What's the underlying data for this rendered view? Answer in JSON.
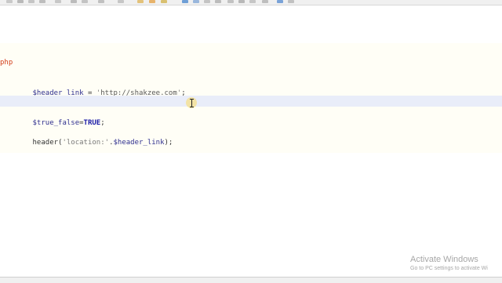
{
  "editor": {
    "open_tag_fragment": "php",
    "lines": [
      {
        "var": "$header_link",
        "op": " = ",
        "q1": "'",
        "url": "http://shakzee.com",
        "q2": "'",
        "end": ";"
      },
      {
        "var": "$true_false",
        "op": "=",
        "kw": "TRUE",
        "end": ";"
      },
      {
        "fn": "header(",
        "str": "'location:'",
        "dot": ".",
        "var": "$header_link",
        "end": ");"
      }
    ]
  },
  "watermark": {
    "title": "Activate Windows",
    "subtitle": "Go to PC settings to activate Wi"
  },
  "colors": {
    "current_line_bg": "#e9edf9",
    "keyword": "#1a1aa6",
    "open_tag": "#d2401c"
  },
  "icons": [
    "toolbar-icons",
    "text-cursor-icon"
  ]
}
